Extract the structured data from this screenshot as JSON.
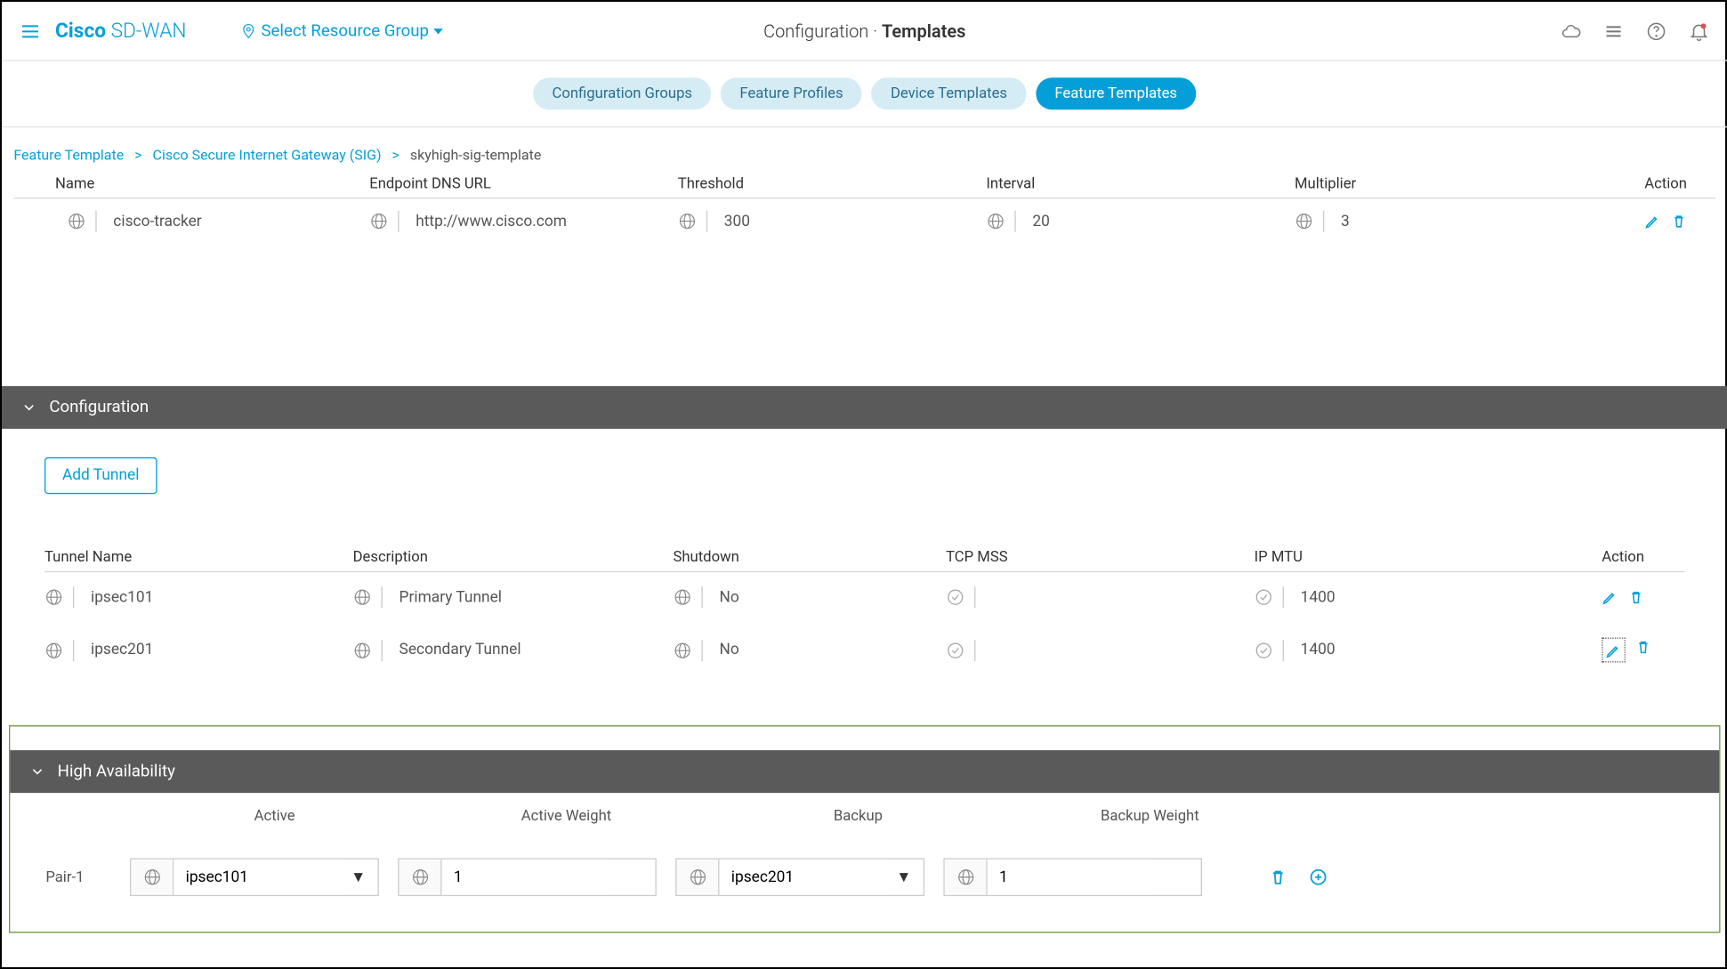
{
  "header": {
    "brand_bold": "Cisco",
    "brand_light": " SD-WAN",
    "resource_group": "Select Resource Group",
    "title_light": "Configuration · ",
    "title_bold": "Templates"
  },
  "tabs": {
    "config_groups": "Configuration Groups",
    "feature_profiles": "Feature Profiles",
    "device_templates": "Device Templates",
    "feature_templates": "Feature Templates"
  },
  "breadcrumb": {
    "a": "Feature Template",
    "b": "Cisco Secure Internet Gateway (SIG)",
    "c": "skyhigh-sig-template"
  },
  "tracker": {
    "headers": {
      "name": "Name",
      "url": "Endpoint DNS URL",
      "threshold": "Threshold",
      "interval": "Interval",
      "multiplier": "Multiplier",
      "action": "Action"
    },
    "row": {
      "name": "cisco-tracker",
      "url": "http://www.cisco.com",
      "threshold": "300",
      "interval": "20",
      "multiplier": "3"
    }
  },
  "sections": {
    "configuration": "Configuration",
    "high_availability": "High Availability"
  },
  "buttons": {
    "add_tunnel": "Add Tunnel"
  },
  "tunnels": {
    "headers": {
      "name": "Tunnel Name",
      "desc": "Description",
      "shutdown": "Shutdown",
      "mss": "TCP MSS",
      "mtu": "IP MTU",
      "action": "Action"
    },
    "rows": [
      {
        "name": "ipsec101",
        "desc": "Primary Tunnel",
        "shutdown": "No",
        "mss": "",
        "mtu": "1400"
      },
      {
        "name": "ipsec201",
        "desc": "Secondary Tunnel",
        "shutdown": "No",
        "mss": "",
        "mtu": "1400"
      }
    ]
  },
  "ha": {
    "headers": {
      "active": "Active",
      "active_weight": "Active Weight",
      "backup": "Backup",
      "backup_weight": "Backup Weight"
    },
    "row": {
      "label": "Pair-1",
      "active": "ipsec101",
      "active_weight": "1",
      "backup": "ipsec201",
      "backup_weight": "1"
    }
  }
}
